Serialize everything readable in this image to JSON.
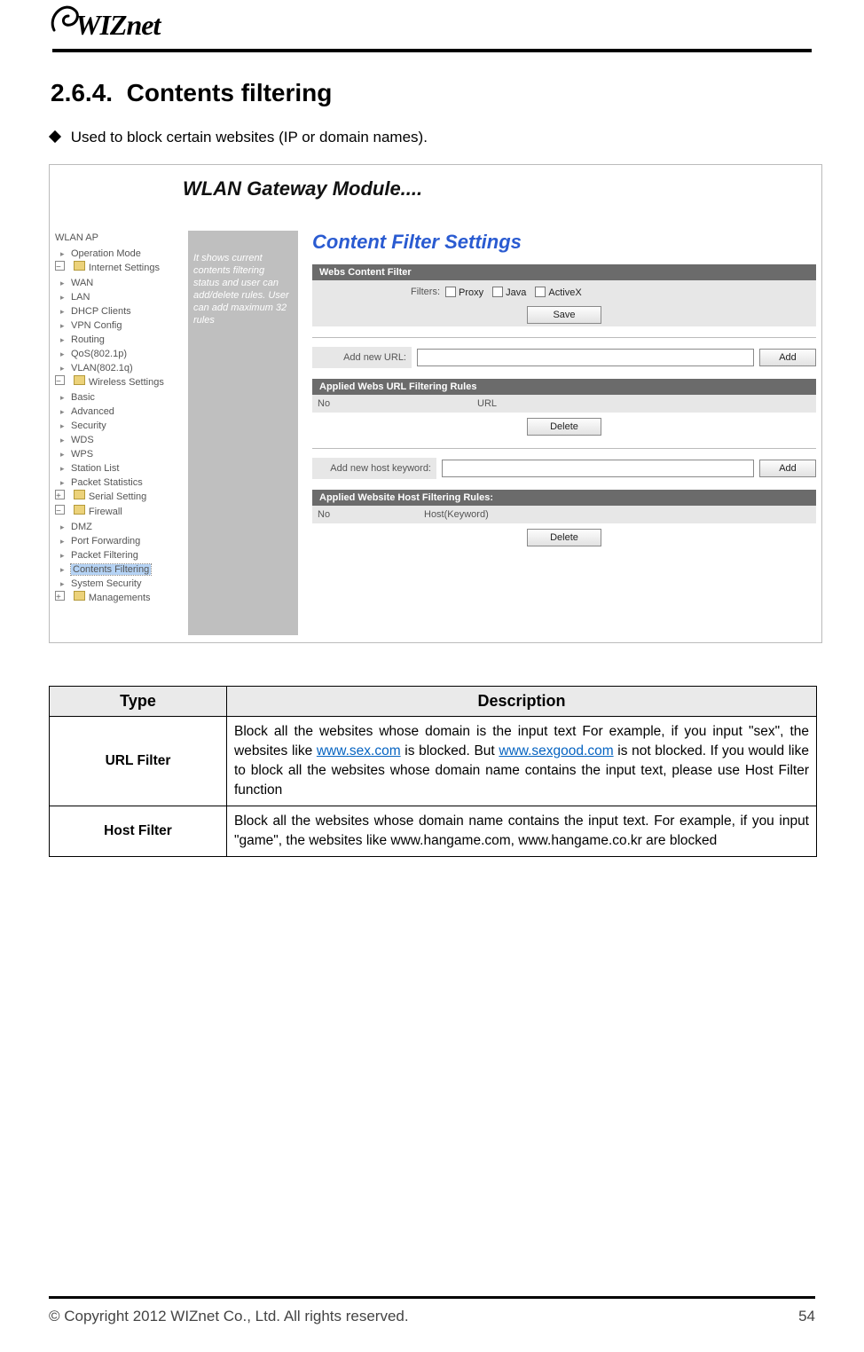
{
  "header": {
    "logo_text": "WIZnet"
  },
  "section": {
    "number": "2.6.4.",
    "title": "Contents filtering",
    "bullet": "Used to block certain websites (IP or domain names)."
  },
  "screenshot": {
    "banner": "WLAN Gateway Module....",
    "tree": {
      "root": "WLAN AP",
      "groups": [
        {
          "label": "Operation Mode",
          "kind": "node"
        },
        {
          "label": "Internet Settings",
          "kind": "folder-open",
          "children": [
            "WAN",
            "LAN",
            "DHCP Clients",
            "VPN Config",
            "Routing",
            "QoS(802.1p)",
            "VLAN(802.1q)"
          ]
        },
        {
          "label": "Wireless Settings",
          "kind": "folder-open",
          "children": [
            "Basic",
            "Advanced",
            "Security",
            "WDS",
            "WPS",
            "Station List",
            "Packet Statistics"
          ]
        },
        {
          "label": "Serial Setting",
          "kind": "folder-closed"
        },
        {
          "label": "Firewall",
          "kind": "folder-open",
          "children": [
            "DMZ",
            "Port Forwarding",
            "Packet Filtering",
            "Contents Filtering",
            "System Security"
          ],
          "selected": "Contents Filtering"
        },
        {
          "label": "Managements",
          "kind": "folder-closed"
        }
      ]
    },
    "help_text": "It shows current contents filtering status and user can add/delete rules. User can add maximum 32 rules",
    "main": {
      "page_title": "Content Filter Settings",
      "webs_filter": {
        "bar": "Webs Content Filter",
        "filters_label": "Filters:",
        "proxy": "Proxy",
        "java": "Java",
        "activex": "ActiveX",
        "save_btn": "Save"
      },
      "url_add": {
        "label": "Add new URL:",
        "btn": "Add"
      },
      "url_rules": {
        "bar": "Applied Webs URL Filtering Rules",
        "col_no": "No",
        "col_url": "URL",
        "delete_btn": "Delete"
      },
      "host_add": {
        "label": "Add new host keyword:",
        "btn": "Add"
      },
      "host_rules": {
        "bar": "Applied Website Host Filtering Rules:",
        "col_no": "No",
        "col_host": "Host(Keyword)",
        "delete_btn": "Delete"
      }
    }
  },
  "table": {
    "head_type": "Type",
    "head_desc": "Description",
    "rows": [
      {
        "type": "URL Filter",
        "desc_pre": "Block all the websites whose domain is the input text\nFor example, if you input \"sex\", the websites like ",
        "link1": "www.sex.com",
        "desc_mid": " is blocked. But ",
        "link2": "www.sexgood.com",
        "desc_post": " is not blocked. If you would like to block all the websites whose domain name contains the input text, please use Host Filter function"
      },
      {
        "type": "Host Filter",
        "desc_plain": "Block all the websites whose domain name contains the input text.\nFor example, if you input \"game\", the websites like www.hangame.com, www.hangame.co.kr are blocked"
      }
    ]
  },
  "footer": {
    "copyright": "© Copyright 2012 WIZnet Co., Ltd. All rights reserved.",
    "page_no": "54"
  }
}
